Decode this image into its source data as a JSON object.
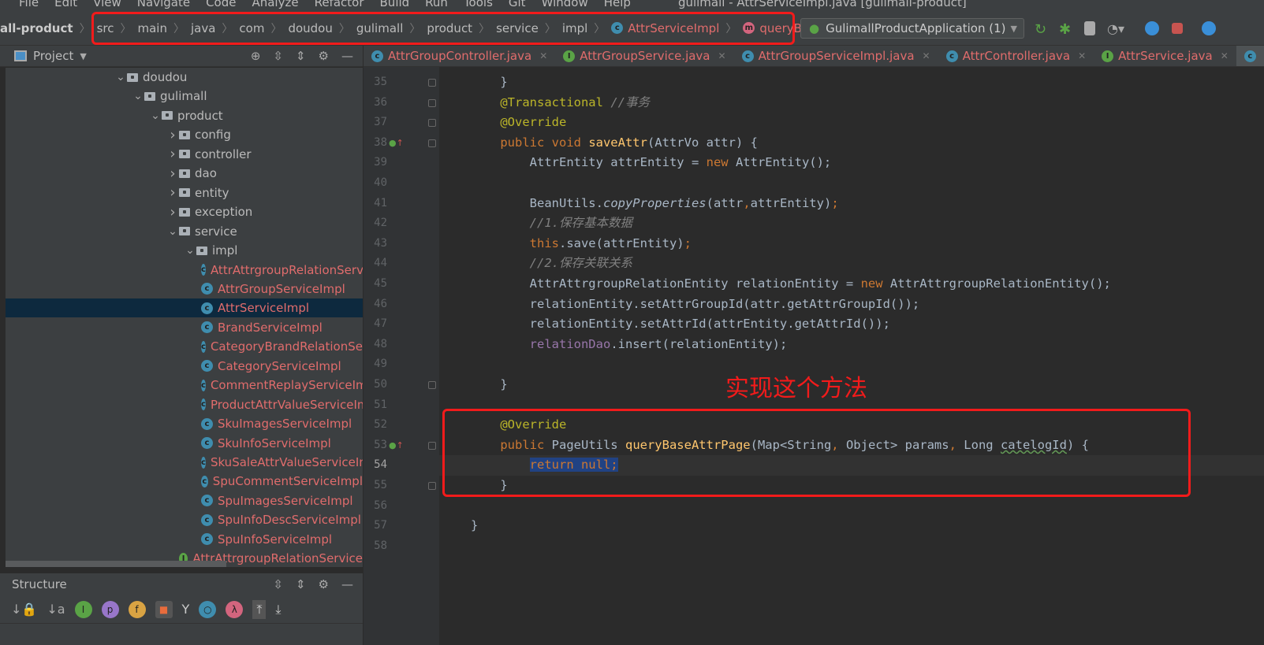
{
  "menu": [
    "File",
    "Edit",
    "View",
    "Navigate",
    "Code",
    "Analyze",
    "Refactor",
    "Build",
    "Run",
    "Tools",
    "Git",
    "Window",
    "Help"
  ],
  "window_title": "gulimall - AttrServiceImpl.java [gulimall-product]",
  "breadcrumb": {
    "module": "all-product",
    "items": [
      "src",
      "main",
      "java",
      "com",
      "doudou",
      "gulimall",
      "product",
      "service",
      "impl"
    ],
    "class": "AttrServiceImpl",
    "method": "queryBaseAttrPage"
  },
  "run_config": "GulimallProductApplication (1)",
  "project_panel": {
    "title": "Project"
  },
  "tree": [
    {
      "label": "doudou",
      "depth": 0,
      "type": "folder",
      "open": true
    },
    {
      "label": "gulimall",
      "depth": 1,
      "type": "folder",
      "open": true
    },
    {
      "label": "product",
      "depth": 2,
      "type": "folder",
      "open": true
    },
    {
      "label": "config",
      "depth": 3,
      "type": "folder",
      "open": false
    },
    {
      "label": "controller",
      "depth": 3,
      "type": "folder",
      "open": false
    },
    {
      "label": "dao",
      "depth": 3,
      "type": "folder",
      "open": false
    },
    {
      "label": "entity",
      "depth": 3,
      "type": "folder",
      "open": false
    },
    {
      "label": "exception",
      "depth": 3,
      "type": "folder",
      "open": false
    },
    {
      "label": "service",
      "depth": 3,
      "type": "folder",
      "open": true
    },
    {
      "label": "impl",
      "depth": 4,
      "type": "folder",
      "open": true
    },
    {
      "label": "AttrAttrgroupRelationServiceImpl",
      "depth": 5,
      "type": "class"
    },
    {
      "label": "AttrGroupServiceImpl",
      "depth": 5,
      "type": "class"
    },
    {
      "label": "AttrServiceImpl",
      "depth": 5,
      "type": "class",
      "selected": true
    },
    {
      "label": "BrandServiceImpl",
      "depth": 5,
      "type": "class"
    },
    {
      "label": "CategoryBrandRelationServiceImpl",
      "depth": 5,
      "type": "class"
    },
    {
      "label": "CategoryServiceImpl",
      "depth": 5,
      "type": "class"
    },
    {
      "label": "CommentReplayServiceImpl",
      "depth": 5,
      "type": "class"
    },
    {
      "label": "ProductAttrValueServiceImpl",
      "depth": 5,
      "type": "class"
    },
    {
      "label": "SkuImagesServiceImpl",
      "depth": 5,
      "type": "class"
    },
    {
      "label": "SkuInfoServiceImpl",
      "depth": 5,
      "type": "class"
    },
    {
      "label": "SkuSaleAttrValueServiceImpl",
      "depth": 5,
      "type": "class"
    },
    {
      "label": "SpuCommentServiceImpl",
      "depth": 5,
      "type": "class"
    },
    {
      "label": "SpuImagesServiceImpl",
      "depth": 5,
      "type": "class"
    },
    {
      "label": "SpuInfoDescServiceImpl",
      "depth": 5,
      "type": "class"
    },
    {
      "label": "SpuInfoServiceImpl",
      "depth": 5,
      "type": "class"
    },
    {
      "label": "AttrAttrgroupRelationService",
      "depth": 4,
      "type": "interface"
    }
  ],
  "structure_panel": {
    "title": "Structure"
  },
  "tabs": [
    {
      "label": "AttrGroupController.java",
      "type": "class"
    },
    {
      "label": "AttrGroupService.java",
      "type": "interface"
    },
    {
      "label": "AttrGroupServiceImpl.java",
      "type": "class"
    },
    {
      "label": "AttrController.java",
      "type": "class"
    },
    {
      "label": "AttrService.java",
      "type": "interface"
    }
  ],
  "code": {
    "first_line": 35,
    "current_line": 54,
    "lines": [
      [
        [
          "    }",
          ""
        ]
      ],
      [
        [
          "    @Transactional ",
          "an"
        ],
        [
          "//事务",
          "cm"
        ]
      ],
      [
        [
          "    @Override",
          "an"
        ]
      ],
      [
        [
          "    public void ",
          "kw"
        ],
        [
          "saveAttr",
          "fn"
        ],
        [
          "(AttrVo attr) {",
          ""
        ]
      ],
      [
        [
          "        AttrEntity attrEntity = ",
          ""
        ],
        [
          "new ",
          "kw"
        ],
        [
          "AttrEntity();",
          ""
        ]
      ],
      [],
      [
        [
          "        BeanUtils.",
          ""
        ],
        [
          "copyProperties",
          "it"
        ],
        [
          "(attr",
          ""
        ],
        [
          ",",
          "kw"
        ],
        [
          "attrEntity)",
          ""
        ],
        [
          ";",
          "kw"
        ]
      ],
      [
        [
          "        //1.保存基本数据",
          "cm"
        ]
      ],
      [
        [
          "        this",
          "kw"
        ],
        [
          ".save(attrEntity)",
          ""
        ],
        [
          ";",
          "kw"
        ]
      ],
      [
        [
          "        //2.保存关联关系",
          "cm"
        ]
      ],
      [
        [
          "        AttrAttrgroupRelationEntity relationEntity = ",
          ""
        ],
        [
          "new ",
          "kw"
        ],
        [
          "AttrAttrgroupRelationEntity();",
          ""
        ]
      ],
      [
        [
          "        relationEntity.setAttrGroupId(attr.getAttrGroupId());",
          ""
        ]
      ],
      [
        [
          "        relationEntity.setAttrId(attrEntity.getAttrId());",
          ""
        ]
      ],
      [
        [
          "        ",
          ""
        ],
        [
          "relationDao",
          "fd"
        ],
        [
          ".insert(relationEntity);",
          ""
        ]
      ],
      [],
      [
        [
          "    }",
          ""
        ]
      ],
      [],
      [
        [
          "    @Override",
          "an"
        ]
      ],
      [
        [
          "    public ",
          "kw"
        ],
        [
          "PageUtils ",
          ""
        ],
        [
          "queryBaseAttrPage",
          "fn"
        ],
        [
          "(Map<String",
          ""
        ],
        [
          ", ",
          "kw"
        ],
        [
          "Object> params",
          ""
        ],
        [
          ", ",
          "kw"
        ],
        [
          "Long ",
          ""
        ],
        [
          "catelogId",
          "wv"
        ],
        [
          ") {",
          ""
        ]
      ],
      [
        [
          "        ",
          ""
        ],
        [
          "return null;",
          "kw sel"
        ]
      ],
      [
        [
          "    }",
          ""
        ]
      ],
      [],
      [
        [
          "}",
          ""
        ]
      ],
      []
    ]
  },
  "annotation": "实现这个方法",
  "colors": {
    "highlight_box": "#f21b1b",
    "keyword": "#cc7832",
    "function": "#ffc66d",
    "annotation": "#bbb529",
    "comment": "#808080"
  }
}
